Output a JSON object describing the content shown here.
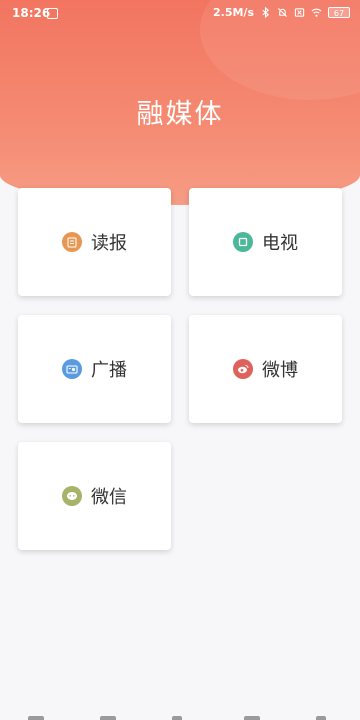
{
  "status_bar": {
    "time": "18:26",
    "network_speed": "2.5M/s",
    "battery": "67",
    "icons": [
      "bluetooth-icon",
      "alarm-off-icon",
      "sim-x-icon",
      "wifi-icon",
      "battery-icon"
    ]
  },
  "header": {
    "title": "融媒体"
  },
  "cards": [
    {
      "label": "读报",
      "icon": "newspaper-icon",
      "color": "#e79752"
    },
    {
      "label": "电视",
      "icon": "tv-icon",
      "color": "#4cb89a"
    },
    {
      "label": "广播",
      "icon": "radio-icon",
      "color": "#5a9be0"
    },
    {
      "label": "微博",
      "icon": "weibo-icon",
      "color": "#e0605a"
    },
    {
      "label": "微信",
      "icon": "wechat-icon",
      "color": "#a8b36a"
    }
  ],
  "colors": {
    "accent": "#f27560",
    "background": "#f7f7f9"
  }
}
